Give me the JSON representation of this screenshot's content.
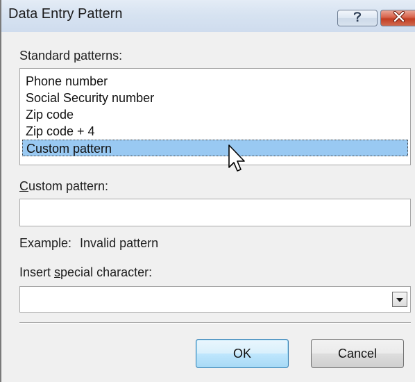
{
  "dialog": {
    "title": "Data Entry Pattern",
    "help_button_icon": "question-mark-icon",
    "close_button_icon": "close-x-icon"
  },
  "standard_patterns": {
    "label_pre": "Standard ",
    "label_mnemonic": "p",
    "label_post": "atterns:",
    "items": [
      "Phone number",
      "Social Security number",
      "Zip code",
      "Zip code + 4",
      "Custom pattern"
    ],
    "selected": "Custom pattern"
  },
  "custom_pattern": {
    "label_mnemonic": "C",
    "label_post": "ustom pattern:",
    "value": ""
  },
  "example": {
    "label": "Example:",
    "value": "Invalid pattern"
  },
  "insert_special": {
    "label_pre": "Insert ",
    "label_mnemonic": "s",
    "label_post": "pecial character:",
    "value": ""
  },
  "buttons": {
    "ok": "OK",
    "cancel": "Cancel"
  },
  "colors": {
    "selection": "#99c9f2",
    "close_button": "#c94a31",
    "default_button_border": "#3c7fb1"
  }
}
